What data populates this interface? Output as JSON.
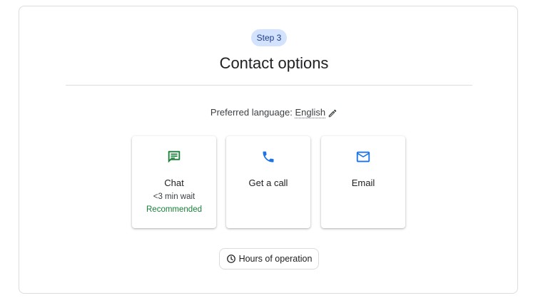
{
  "header": {
    "step_label": "Step 3",
    "title": "Contact options"
  },
  "language": {
    "prefix": "Preferred language: ",
    "value": "English",
    "edit_icon": "pencil-icon"
  },
  "options": [
    {
      "label": "Chat",
      "wait": "<3 min wait",
      "badge": "Recommended",
      "icon": "chat-icon",
      "icon_color": "#188038"
    },
    {
      "label": "Get a call",
      "icon": "phone-icon",
      "icon_color": "#1a73e8"
    },
    {
      "label": "Email",
      "icon": "mail-icon",
      "icon_color": "#1a73e8"
    }
  ],
  "hours_button": {
    "label": "Hours of operation",
    "icon": "clock-icon"
  },
  "colors": {
    "step_pill_bg": "#d3e3fd",
    "recommended_green": "#188038",
    "accent_blue": "#1a73e8",
    "border": "#dadce0"
  }
}
